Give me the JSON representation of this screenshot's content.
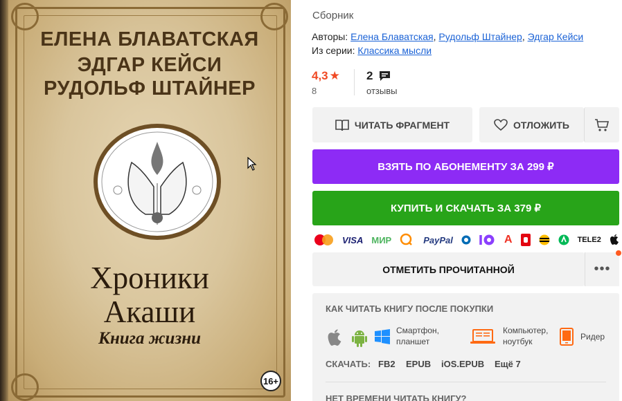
{
  "cover": {
    "authors": [
      "ЕЛЕНА БЛАВАТСКАЯ",
      "ЭДГАР КЕЙСИ",
      "РУДОЛЬФ ШТАЙНЕР"
    ],
    "title_line1": "Хроники",
    "title_line2": "Акаши",
    "subtitle": "Книга жизни",
    "age_rating": "16+"
  },
  "book": {
    "type": "Сборник",
    "authors_label": "Авторы:",
    "authors": [
      "Елена Блаватская",
      "Рудольф Штайнер",
      "Эдгар Кейси"
    ],
    "series_label": "Из серии:",
    "series": "Классика мысли"
  },
  "rating": {
    "value": "4,3",
    "count": "8",
    "reviews_count": "2",
    "reviews_label": "отзывы"
  },
  "actions": {
    "read_fragment": "ЧИТАТЬ ФРАГМЕНТ",
    "postpone": "ОТЛОЖИТЬ",
    "subscribe": "ВЗЯТЬ ПО АБОНЕМЕНТУ ЗА 299 ₽",
    "buy": "КУПИТЬ И СКАЧАТЬ ЗА 379 ₽",
    "mark_read": "ОТМЕТИТЬ ПРОЧИТАННОЙ",
    "more": "•••"
  },
  "payments": {
    "visa": "VISA",
    "mir": "МИР",
    "paypal": "PayPal",
    "tele2": "TELE2"
  },
  "howto": {
    "title": "КАК ЧИТАТЬ КНИГУ ПОСЛЕ ПОКУПКИ",
    "smartphone": "Смартфон,",
    "tablet": "планшет",
    "computer": "Компьютер,",
    "laptop": "ноутбук",
    "reader": "Ридер",
    "download_label": "СКАЧАТЬ:",
    "formats": [
      "FB2",
      "EPUB",
      "iOS.EPUB",
      "Ещё 7"
    ],
    "next_title": "НЕТ ВРЕМЕНИ ЧИТАТЬ КНИГУ?"
  },
  "colors": {
    "accent_orange": "#f04a25",
    "subscribe_purple": "#8d2bf5",
    "buy_green": "#28a419",
    "link_blue": "#1a62d6"
  }
}
